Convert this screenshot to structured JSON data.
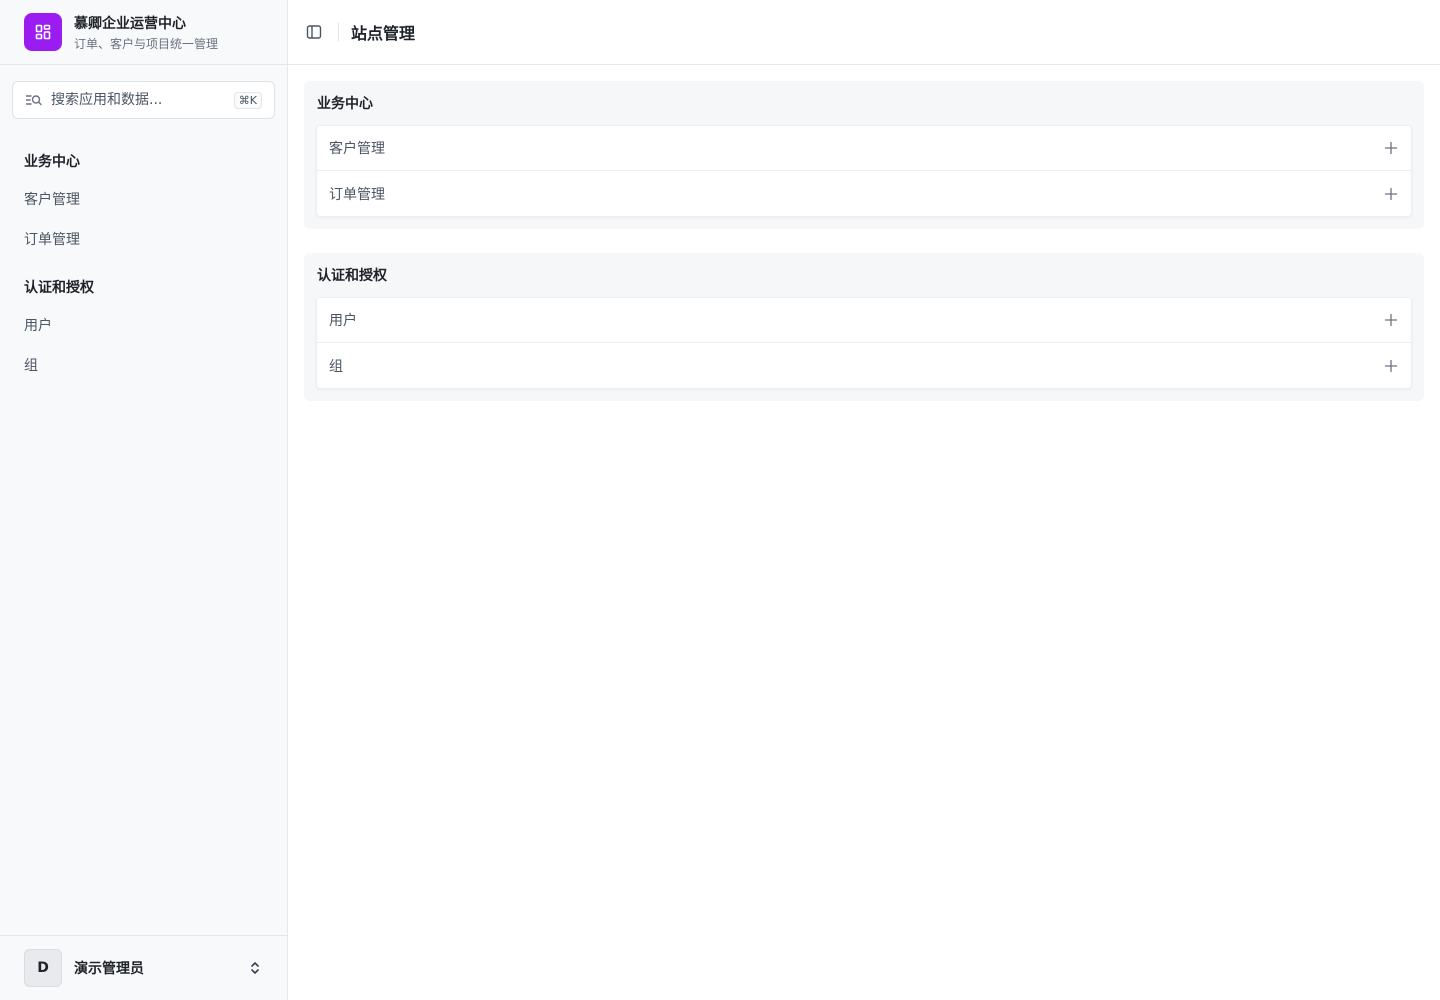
{
  "brand": {
    "name": "慕卿企业运营中心",
    "subtitle": "订单、客户与项目统一管理",
    "logo_icon": "layout-grid-icon",
    "accent": "#9a1cf0"
  },
  "search": {
    "placeholder": "搜索应用和数据...",
    "shortcut": "⌘K"
  },
  "sidebar": {
    "groups": [
      {
        "title": "业务中心",
        "items": [
          {
            "label": "客户管理"
          },
          {
            "label": "订单管理"
          }
        ]
      },
      {
        "title": "认证和授权",
        "items": [
          {
            "label": "用户"
          },
          {
            "label": "组"
          }
        ]
      }
    ]
  },
  "user": {
    "avatar_letter": "D",
    "name": "演示管理员"
  },
  "header": {
    "title": "站点管理"
  },
  "main": {
    "sections": [
      {
        "title": "业务中心",
        "rows": [
          {
            "label": "客户管理"
          },
          {
            "label": "订单管理"
          }
        ]
      },
      {
        "title": "认证和授权",
        "rows": [
          {
            "label": "用户"
          },
          {
            "label": "组"
          }
        ]
      }
    ]
  }
}
